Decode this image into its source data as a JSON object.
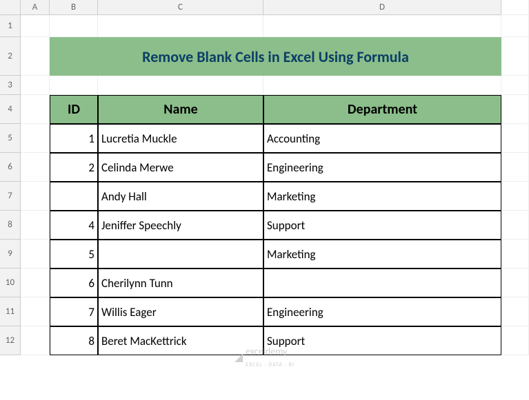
{
  "columns": [
    "A",
    "B",
    "C",
    "D"
  ],
  "rows": [
    "1",
    "2",
    "3",
    "4",
    "5",
    "6",
    "7",
    "8",
    "9",
    "10",
    "11",
    "12"
  ],
  "title": "Remove Blank Cells in Excel Using Formula",
  "headers": {
    "id": "ID",
    "name": "Name",
    "dept": "Department"
  },
  "data": [
    {
      "id": "1",
      "name": "Lucretia Muckle",
      "dept": "Accounting"
    },
    {
      "id": "2",
      "name": "Celinda Merwe",
      "dept": "Engineering"
    },
    {
      "id": "",
      "name": "Andy Hall",
      "dept": "Marketing"
    },
    {
      "id": "4",
      "name": "Jeniffer Speechly",
      "dept": "Support"
    },
    {
      "id": "5",
      "name": "",
      "dept": "Marketing"
    },
    {
      "id": "6",
      "name": "Cherilynn Tunn",
      "dept": ""
    },
    {
      "id": "7",
      "name": "Willis Eager",
      "dept": "Engineering"
    },
    {
      "id": "8",
      "name": "Beret MacKettrick",
      "dept": "Support"
    }
  ],
  "watermark": {
    "main": "exceldemy",
    "sub": "EXCEL · DATA · BI"
  }
}
